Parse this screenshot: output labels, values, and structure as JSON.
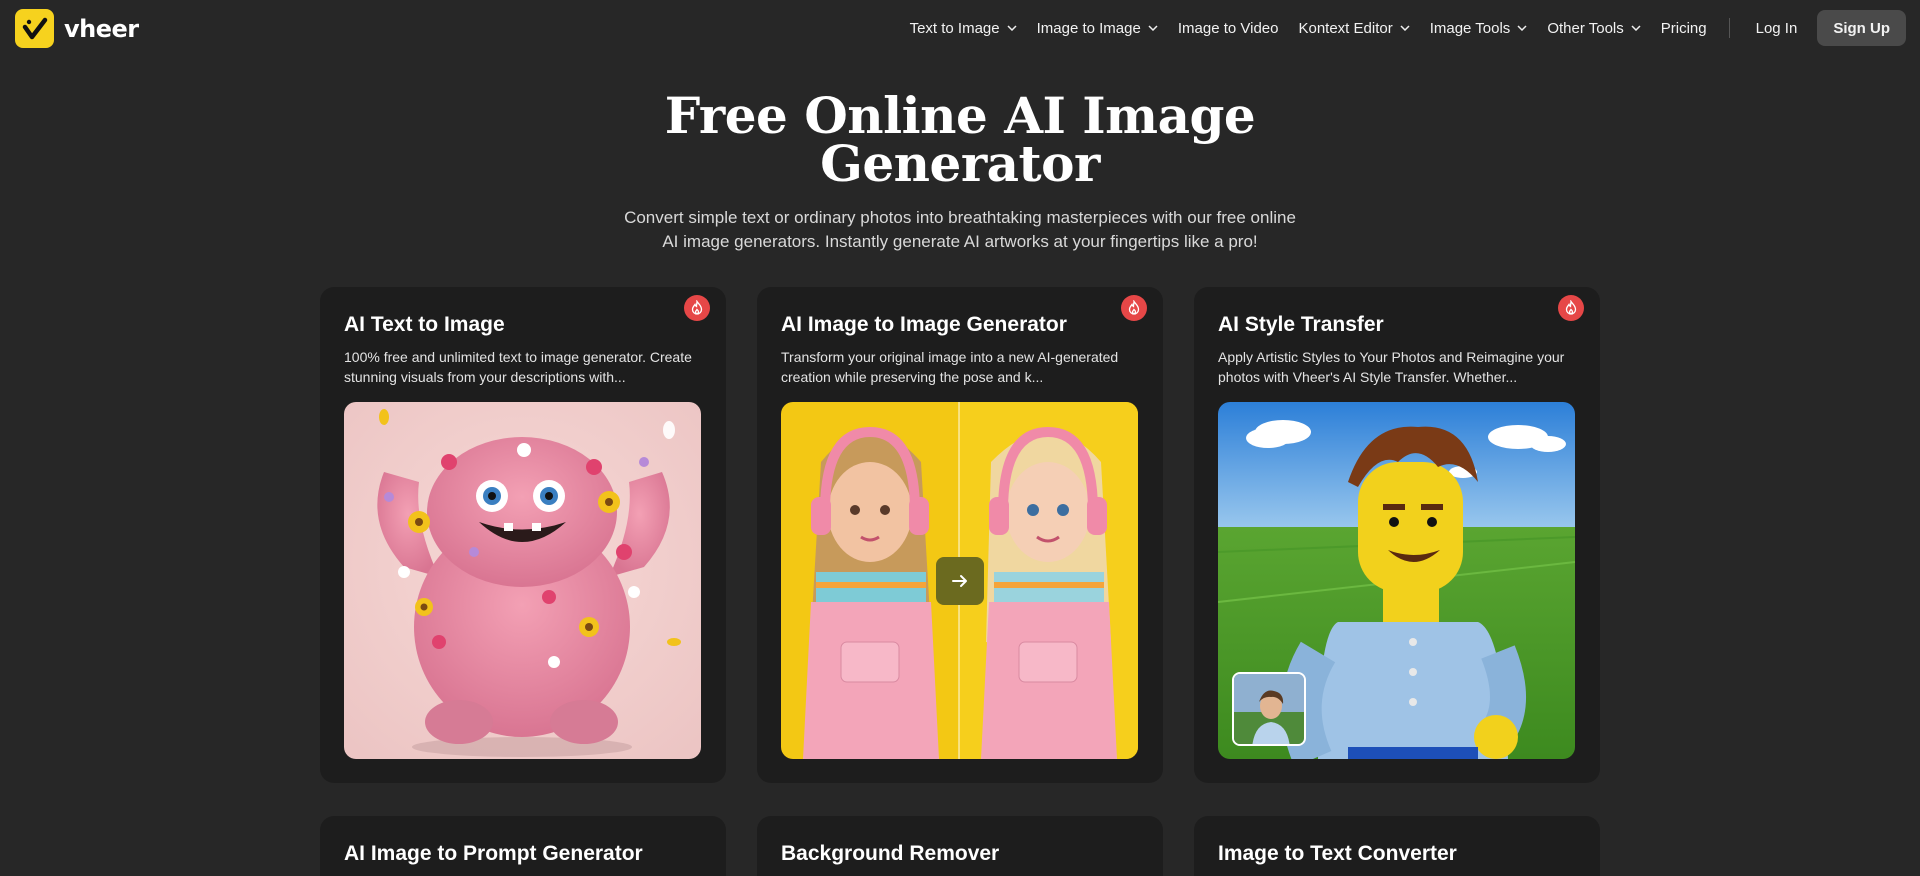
{
  "brand": {
    "name": "vheer"
  },
  "nav": {
    "items": [
      {
        "label": "Text to Image",
        "dropdown": true
      },
      {
        "label": "Image to Image",
        "dropdown": true
      },
      {
        "label": "Image to Video",
        "dropdown": false
      },
      {
        "label": "Kontext Editor",
        "dropdown": true
      },
      {
        "label": "Image Tools",
        "dropdown": true
      },
      {
        "label": "Other Tools",
        "dropdown": true
      },
      {
        "label": "Pricing",
        "dropdown": false
      }
    ],
    "login": "Log In",
    "signup": "Sign Up"
  },
  "hero": {
    "title_line1": "Free Online AI Image",
    "title_line2": "Generator",
    "subtitle": "Convert simple text or ordinary photos into breathtaking masterpieces with our free online AI image generators. Instantly generate AI artworks at your fingertips like a pro!"
  },
  "cards": [
    {
      "title": "AI Text to Image",
      "description": "100% free and unlimited text to image generator. Create stunning visuals from your descriptions with...",
      "badge": "hot-icon"
    },
    {
      "title": "AI Image to Image Generator",
      "description": "Transform your original image into a new AI-generated creation while preserving the pose and k...",
      "badge": "hot-icon"
    },
    {
      "title": "AI Style Transfer",
      "description": "Apply Artistic Styles to Your Photos and Reimagine your photos with Vheer's AI Style Transfer. Whether...",
      "badge": "hot-icon"
    },
    {
      "title": "AI Image to Prompt Generator"
    },
    {
      "title": "Background Remover"
    },
    {
      "title": "Image to Text Converter"
    }
  ],
  "colors": {
    "background": "#272727",
    "card": "#1d1d1d",
    "accent_yellow": "#f6d21e",
    "hot_badge": "#e64747"
  }
}
